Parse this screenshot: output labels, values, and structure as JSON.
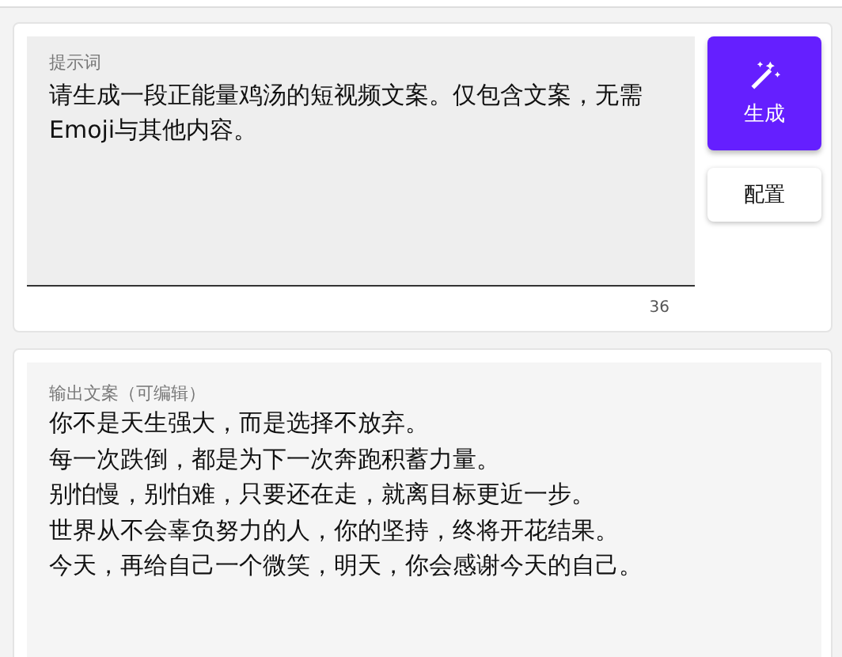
{
  "prompt": {
    "label": "提示词",
    "value": "请生成一段正能量鸡汤的短视频文案。仅包含文案，无需Emoji与其他内容。",
    "count": "36"
  },
  "buttons": [
    {
      "kind": "primary",
      "label": "生成"
    },
    {
      "kind": "plain",
      "label": "配置"
    }
  ],
  "output": {
    "label": "输出文案（可编辑）",
    "lines": [
      "你不是天生强大，而是选择不放弃。",
      "每一次跌倒，都是为下一次奔跑积蓄力量。",
      "别怕慢，别怕难，只要还在走，就离目标更近一步。",
      "世界从不会辜负努力的人，你的坚持，终将开花结果。",
      "今天，再给自己一个微笑，明天，你会感谢今天的自己。"
    ]
  }
}
